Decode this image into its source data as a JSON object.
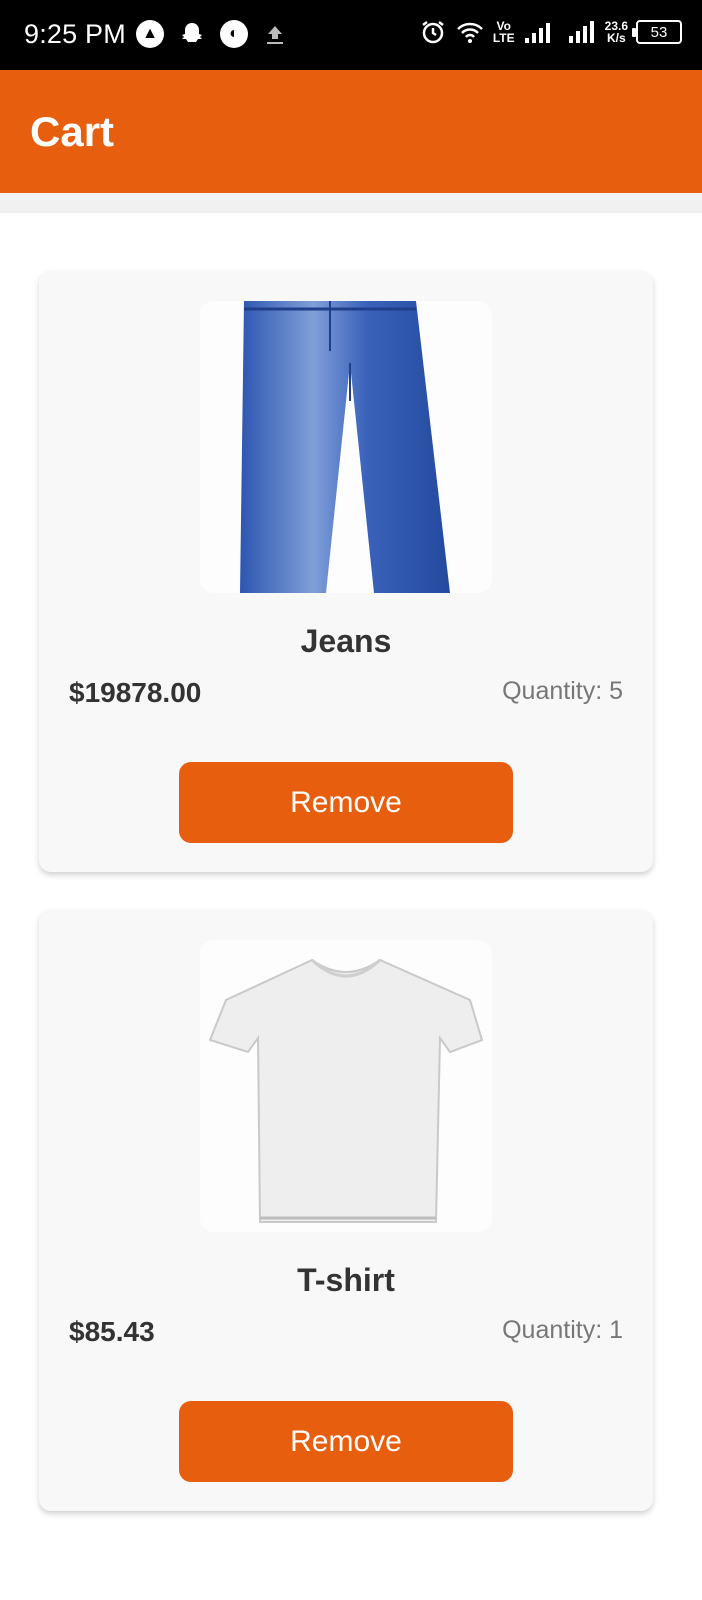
{
  "status_bar": {
    "time": "9:25 PM",
    "network_speed": "23.6",
    "network_unit": "K/s",
    "volte": "Vo",
    "lte": "LTE",
    "battery": "53"
  },
  "app_bar": {
    "title": "Cart"
  },
  "cart": {
    "items": [
      {
        "name": "Jeans",
        "price": "$19878.00",
        "quantity_label": "Quantity: 5",
        "remove_label": "Remove",
        "image": "jeans-icon"
      },
      {
        "name": "T-shirt",
        "price": "$85.43",
        "quantity_label": "Quantity: 1",
        "remove_label": "Remove",
        "image": "tshirt-icon"
      }
    ]
  },
  "colors": {
    "accent": "#e65e0e",
    "card_bg": "#f8f8f8",
    "text": "#333333",
    "muted": "#777777"
  }
}
